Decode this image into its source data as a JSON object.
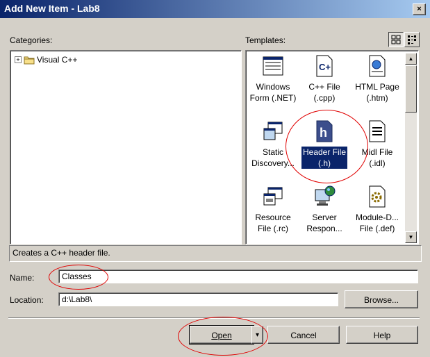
{
  "window": {
    "title": "Add New Item - Lab8",
    "close_glyph": "×"
  },
  "categories": {
    "label": "Categories:",
    "items": [
      {
        "expander": "+",
        "label": "Visual C++"
      }
    ]
  },
  "templates": {
    "label": "Templates:",
    "items": [
      {
        "line1": "Windows",
        "line2": "Form (.NET)",
        "icon": "windows-form-icon"
      },
      {
        "line1": "C++ File",
        "line2": "(.cpp)",
        "icon": "cpp-file-icon"
      },
      {
        "line1": "HTML Page",
        "line2": "(.htm)",
        "icon": "html-page-icon"
      },
      {
        "line1": "Static",
        "line2": "Discovery...",
        "icon": "static-discovery-icon"
      },
      {
        "line1": "Header File",
        "line2": "(.h)",
        "icon": "header-file-icon",
        "selected": true
      },
      {
        "line1": "Midl File",
        "line2": "(.idl)",
        "icon": "midl-file-icon"
      },
      {
        "line1": "Resource",
        "line2": "File (.rc)",
        "icon": "resource-file-icon"
      },
      {
        "line1": "Server",
        "line2": "Respon...",
        "icon": "server-response-icon"
      },
      {
        "line1": "Module-D...",
        "line2": "File (.def)",
        "icon": "module-def-icon"
      }
    ]
  },
  "status": "Creates a C++ header file.",
  "name": {
    "label": "Name:",
    "value": "Classes"
  },
  "location": {
    "label": "Location:",
    "value": "d:\\Lab8\\"
  },
  "buttons": {
    "browse": "Browse...",
    "open": "Open",
    "cancel": "Cancel",
    "help": "Help",
    "open_arrow": "▾"
  },
  "scroll": {
    "up": "▲",
    "down": "▼"
  },
  "colors": {
    "titlebar_start": "#0a246a",
    "titlebar_end": "#a6caf0",
    "selection": "#0a246a",
    "annotation": "#e00000"
  }
}
